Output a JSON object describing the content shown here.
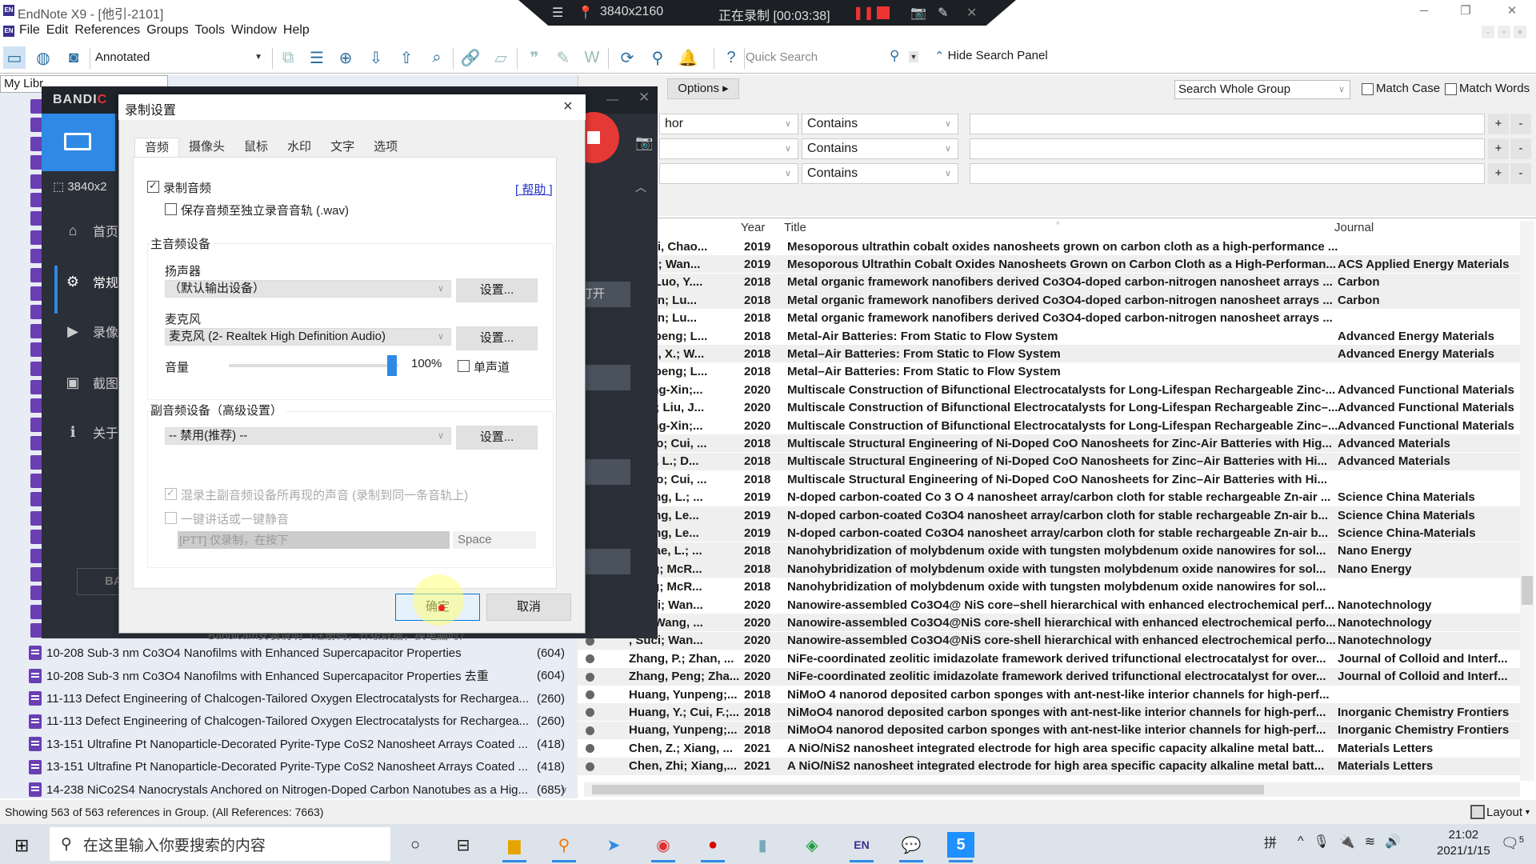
{
  "window": {
    "title": "EndNote X9 - [他引-2101]",
    "logo": "EN"
  },
  "menu": [
    "File",
    "Edit",
    "References",
    "Groups",
    "Tools",
    "Window",
    "Help"
  ],
  "toolbar": {
    "style": "Annotated",
    "quick_search_placeholder": "Quick Search",
    "hide_search_panel": "Hide Search Panel",
    "icons": [
      "local-library-icon",
      "online-search-icon",
      "integrated-library-icon",
      "new-group-icon",
      "new-reference-icon",
      "find-fulltext-icon",
      "import-icon",
      "export-icon",
      "find-pdf-icon",
      "link-icon",
      "open-folder-icon",
      "insert-citation-icon",
      "format-bibliography-icon",
      "word-icon",
      "sync-icon",
      "share-icon",
      "alerts-icon",
      "help-icon"
    ]
  },
  "search_panel": {
    "options": "Options",
    "scope": "Search Whole Group",
    "match_case": "Match Case",
    "match_words": "Match Words",
    "rows": [
      {
        "field": "hor",
        "op": "Contains",
        "value": ""
      },
      {
        "field": "",
        "op": "Contains",
        "value": ""
      },
      {
        "field": "",
        "op": "Contains",
        "value": ""
      }
    ],
    "plus": "+",
    "minus": "-"
  },
  "library": {
    "label": "My Libr"
  },
  "groups": [
    {
      "title": "10-208 Sub-3 nm Co3O4 Nanofilms with Enhanced Supercapacitor Properties",
      "count": "(604)"
    },
    {
      "title": "10-208 Sub-3 nm Co3O4 Nanofilms with Enhanced Supercapacitor Properties 去重",
      "count": "(604)"
    },
    {
      "title": "11-113 Defect Engineering of Chalcogen-Tailored Oxygen Electrocatalysts for Rechargea...",
      "count": "(260)"
    },
    {
      "title": "11-113 Defect Engineering of Chalcogen-Tailored Oxygen Electrocatalysts for Rechargea...",
      "count": "(260)"
    },
    {
      "title": "13-151 Ultrafine Pt Nanoparticle-Decorated Pyrite-Type CoS2 Nanosheet Arrays Coated ...",
      "count": "(418)"
    },
    {
      "title": "13-151 Ultrafine Pt Nanoparticle-Decorated Pyrite-Type CoS2 Nanosheet Arrays Coated ...",
      "count": "(418)"
    },
    {
      "title": "14-238 NiCo2S4 Nanocrystals Anchored on Nitrogen-Doped Carbon Nanotubes as a Hig...",
      "count": "(685)"
    }
  ],
  "columns": {
    "year": "Year",
    "title": "Title",
    "journal": "Journal"
  },
  "references": [
    {
      "author": "an; Li, Chao...",
      "year": "2019",
      "title": "Mesoporous ultrathin cobalt oxides nanosheets grown on carbon cloth as a high-performance ...",
      "journal": ""
    },
    {
      "author": "Li, C.; Wan...",
      "year": "2019",
      "title": "Mesoporous Ultrathin Cobalt Oxides Nanosheets Grown on Carbon Cloth as a High-Performan...",
      "journal": "ACS Applied Energy Materials"
    },
    {
      "author": ", X.; Luo, Y....",
      "year": "2018",
      "title": "Metal organic framework nanofibers derived Co3O4-doped carbon-nitrogen nanosheet arrays ...",
      "journal": "Carbon"
    },
    {
      "author": ", Xuan; Lu...",
      "year": "2018",
      "title": "Metal organic framework nanofibers derived Co3O4-doped carbon-nitrogen nanosheet arrays ...",
      "journal": "Carbon"
    },
    {
      "author": ", Xuan; Lu...",
      "year": "2018",
      "title": "Metal organic framework nanofibers derived Co3O4-doped carbon-nitrogen nanosheet arrays ...",
      "journal": ""
    },
    {
      "author": "Xiaopeng; L...",
      "year": "2018",
      "title": "Metal-Air Batteries: From Static to Flow System",
      "journal": "Advanced Energy Materials"
    },
    {
      "author": "X.; Li, X.; W...",
      "year": "2018",
      "title": "Metal–Air Batteries: From Static to Flow System",
      "journal": "Advanced Energy Materials"
    },
    {
      "author": "Xiaopeng; L...",
      "year": "2018",
      "title": "Metal–Air Batteries: From Static to Flow System",
      "journal": ""
    },
    {
      "author": "Chang-Xin;...",
      "year": "2020",
      "title": "Multiscale Construction of Bifunctional Electrocatalysts for Long-Lifespan Rechargeable Zinc-...",
      "journal": "Advanced Functional Materials"
    },
    {
      "author": "C. X.; Liu, J...",
      "year": "2020",
      "title": "Multiscale Construction of Bifunctional Electrocatalysts for Long-Lifespan Rechargeable Zinc–...",
      "journal": "Advanced Functional Materials"
    },
    {
      "author": "Chang-Xin;...",
      "year": "2020",
      "title": "Multiscale Construction of Bifunctional Electrocatalysts for Long-Lifespan Rechargeable Zinc–...",
      "journal": "Advanced Functional Materials"
    },
    {
      "author": "e-Jiao; Cui, ...",
      "year": "2018",
      "title": "Multiscale Structural Engineering of Ni-Doped CoO Nanosheets for Zinc-Air Batteries with Hig...",
      "journal": "Advanced Materials"
    },
    {
      "author": "; Cui, L.; D...",
      "year": "2018",
      "title": "Multiscale Structural Engineering of Ni-Doped CoO Nanosheets for Zinc–Air Batteries with Hi...",
      "journal": "Advanced Materials"
    },
    {
      "author": "e-Jiao; Cui, ...",
      "year": "2018",
      "title": "Multiscale Structural Engineering of Ni-Doped CoO Nanosheets for Zinc–Air Batteries with Hi...",
      "journal": ""
    },
    {
      "author": "; Wang, L.; ...",
      "year": "2019",
      "title": "N-doped carbon-coated Co 3 O 4 nanosheet array/carbon cloth for stable rechargeable Zn-air ...",
      "journal": "Science China Materials"
    },
    {
      "author": "; Wang, Le...",
      "year": "2019",
      "title": "N-doped carbon-coated Co3O4 nanosheet array/carbon cloth for stable rechargeable Zn-air b...",
      "journal": "Science China Materials"
    },
    {
      "author": "; Wang, Le...",
      "year": "2019",
      "title": "N-doped carbon-coated Co3O4 nanosheet array/carbon cloth for stable rechargeable Zn-air b...",
      "journal": "Science China-Materials"
    },
    {
      "author": "McRae, L.; ...",
      "year": "2018",
      "title": "Nanohybridization of molybdenum oxide with tungsten molybdenum oxide nanowires for sol...",
      "journal": "Nano Energy"
    },
    {
      "author": "izeng; McR...",
      "year": "2018",
      "title": "Nanohybridization of molybdenum oxide with tungsten molybdenum oxide nanowires for sol...",
      "journal": "Nano Energy"
    },
    {
      "author": "izeng; McR...",
      "year": "2018",
      "title": "Nanohybridization of molybdenum oxide with tungsten molybdenum oxide nanowires for sol...",
      "journal": ""
    },
    {
      "author": ", Suci; Wan...",
      "year": "2020",
      "title": "Nanowire-assembled Co3O4@ NiS core–shell hierarchical with enhanced electrochemical perf...",
      "journal": "Nanotechnology"
    },
    {
      "author": ", S.; Wang, ...",
      "year": "2020",
      "title": "Nanowire-assembled Co3O4@NiS core-shell hierarchical with enhanced electrochemical perfo...",
      "journal": "Nanotechnology"
    },
    {
      "author": ", Suci; Wan...",
      "year": "2020",
      "title": "Nanowire-assembled Co3O4@NiS core-shell hierarchical with enhanced electrochemical perfo...",
      "journal": "Nanotechnology"
    },
    {
      "author": "Zhang, P.; Zhan, ...",
      "year": "2020",
      "title": "NiFe-coordinated zeolitic imidazolate framework derived trifunctional electrocatalyst for over...",
      "journal": "Journal of Colloid and Interf..."
    },
    {
      "author": "Zhang, Peng; Zha...",
      "year": "2020",
      "title": "NiFe-coordinated zeolitic imidazolate framework derived trifunctional electrocatalyst for over...",
      "journal": "Journal of Colloid and Interf..."
    },
    {
      "author": "Huang, Yunpeng;...",
      "year": "2018",
      "title": "NiMoO 4 nanorod deposited carbon sponges with ant-nest-like interior channels for high-perf...",
      "journal": ""
    },
    {
      "author": "Huang, Y.; Cui, F.;...",
      "year": "2018",
      "title": "NiMoO4 nanorod deposited carbon sponges with ant-nest-like interior channels for high-perf...",
      "journal": "Inorganic Chemistry Frontiers"
    },
    {
      "author": "Huang, Yunpeng;...",
      "year": "2018",
      "title": "NiMoO4 nanorod deposited carbon sponges with ant-nest-like interior channels for high-perf...",
      "journal": "Inorganic Chemistry Frontiers"
    },
    {
      "author": "Chen, Z.; Xiang, ...",
      "year": "2021",
      "title": "A NiO/NiS2 nanosheet integrated electrode for high area specific capacity alkaline metal batt...",
      "journal": "Materials Letters"
    },
    {
      "author": "Chen, Zhi; Xiang,...",
      "year": "2021",
      "title": "A NiO/NiS2 nanosheet integrated electrode for high area specific capacity alkaline metal batt...",
      "journal": "Materials Letters"
    }
  ],
  "status": {
    "text": "Showing 563 of 563 references in Group. (All References: 7663)",
    "layout": "Layout"
  },
  "bandicam": {
    "brand": "BANDICAM",
    "brand_short": "BAND",
    "resolution": "3840x2",
    "nav": [
      "首页",
      "常规",
      "录像",
      "截图",
      "关于"
    ],
    "open_btn": "打开",
    "promo": "Bandicam安装说明（注册码，升级数据，换电脑时）"
  },
  "recording_bar": {
    "resolution": "3840x2160",
    "status": "正在录制 [00:03:38]"
  },
  "dialog": {
    "title": "录制设置",
    "tabs": [
      "音频",
      "摄像头",
      "鼠标",
      "水印",
      "文字",
      "选项"
    ],
    "active_tab": 0,
    "record_audio": {
      "label": "录制音频",
      "checked": true
    },
    "separate_track": {
      "label": "保存音频至独立录音音轨 (.wav)",
      "checked": false
    },
    "help": "[ 帮助 ]",
    "primary_group": "主音频设备",
    "speaker_label": "扬声器",
    "speaker_value": "（默认输出设备）",
    "mic_label": "麦克风",
    "mic_value": "麦克风 (2- Realtek High Definition Audio)",
    "settings_btn": "设置...",
    "volume_label": "音量",
    "volume_value": "100%",
    "volume_percent": 100,
    "mono": {
      "label": "单声道",
      "checked": false
    },
    "secondary_group": "副音频设备（高级设置）",
    "secondary_value": "-- 禁用(推荐) --",
    "mix": {
      "label": "混录主副音频设备所再现的声音 (录制到同一条音轨上)",
      "checked": true
    },
    "ptt": {
      "label": "一键讲话或一键静音",
      "checked": false
    },
    "ptt_mode": "[PTT] 仅录制，在按下",
    "ptt_key": "Space",
    "ok": "确定",
    "cancel": "取消"
  },
  "taskbar": {
    "search_placeholder": "在这里输入你要搜索的内容",
    "ime": "拼",
    "time": "21:02",
    "date": "2021/1/15",
    "notifications": "5"
  }
}
